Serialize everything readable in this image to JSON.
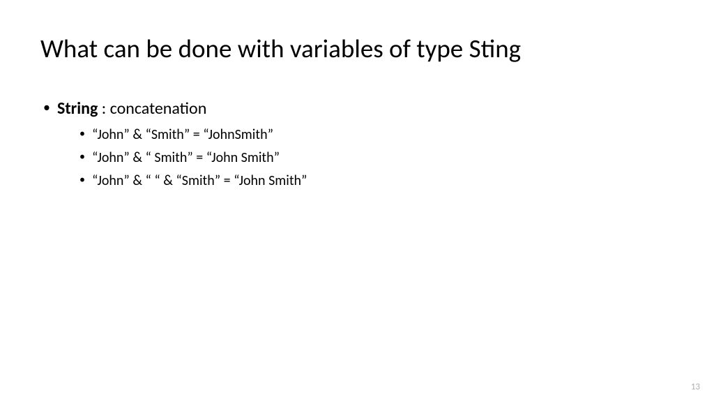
{
  "title": "What can be done with variables of type Sting",
  "bullet": {
    "strong": "String",
    "rest": " : concatenation"
  },
  "examples": [
    "“John” & “Smith” = “JohnSmith”",
    "“John” & “ Smith” = “John Smith”",
    "“John” & “ “ & “Smith” = “John Smith”"
  ],
  "page_number": "13"
}
